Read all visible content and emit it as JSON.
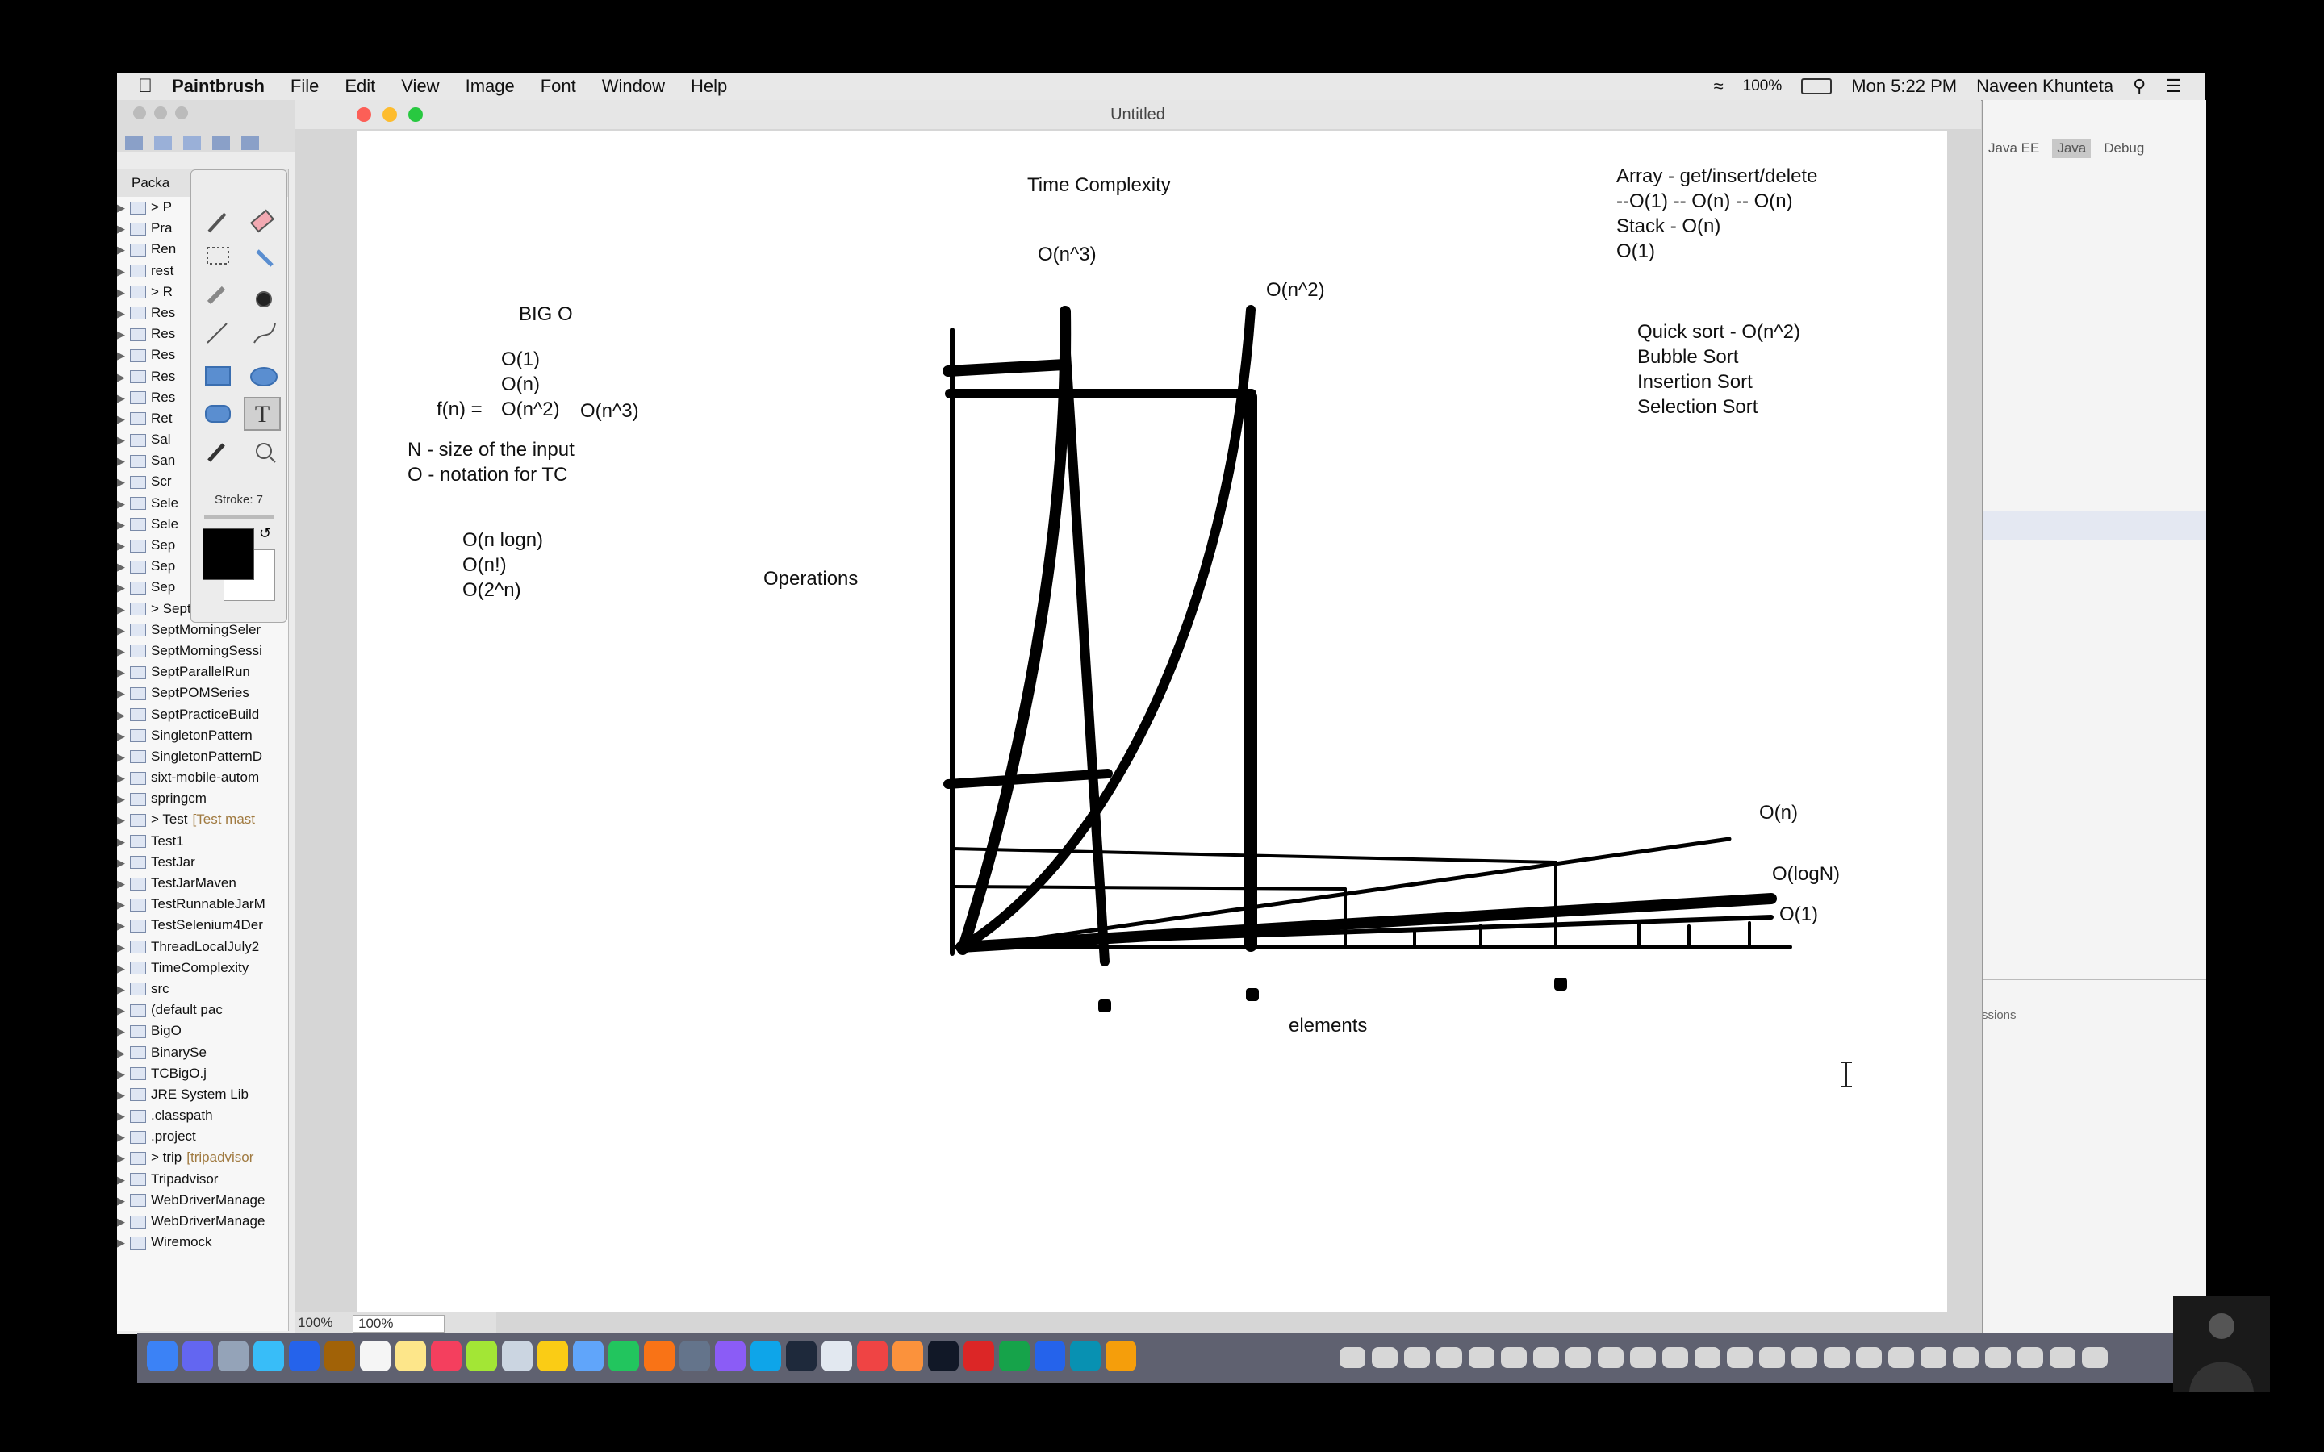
{
  "menubar": {
    "app": "Paintbrush",
    "items": [
      "File",
      "Edit",
      "View",
      "Image",
      "Font",
      "Window",
      "Help"
    ],
    "battery": "100%",
    "clock": "Mon 5:22 PM",
    "user": "Naveen Khunteta"
  },
  "window": {
    "title": "Untitled"
  },
  "eclipse": {
    "package_tab": "Packa",
    "perspectives": [
      "Java EE",
      "Java",
      "Debug"
    ],
    "sessions_label": "ssions",
    "tree": [
      {
        "label": "> P",
        "deco": ""
      },
      {
        "label": "Pra",
        "deco": ""
      },
      {
        "label": "Ren",
        "deco": ""
      },
      {
        "label": "rest",
        "deco": ""
      },
      {
        "label": "> R",
        "deco": ""
      },
      {
        "label": "Res",
        "deco": ""
      },
      {
        "label": "Res",
        "deco": ""
      },
      {
        "label": "Res",
        "deco": ""
      },
      {
        "label": "Res",
        "deco": ""
      },
      {
        "label": "Res",
        "deco": ""
      },
      {
        "label": "Ret",
        "deco": ""
      },
      {
        "label": "Sal",
        "deco": ""
      },
      {
        "label": "San",
        "deco": ""
      },
      {
        "label": "Scr",
        "deco": ""
      },
      {
        "label": "Sele",
        "deco": ""
      },
      {
        "label": "Sele",
        "deco": ""
      },
      {
        "label": "Sep",
        "deco": ""
      },
      {
        "label": "Sep",
        "deco": ""
      },
      {
        "label": "Sep",
        "deco": ""
      },
      {
        "label": "> SeptMorningSel",
        "deco": ""
      },
      {
        "label": "SeptMorningSeler",
        "deco": ""
      },
      {
        "label": "SeptMorningSessi",
        "deco": ""
      },
      {
        "label": "SeptParallelRun",
        "deco": ""
      },
      {
        "label": "SeptPOMSeries",
        "deco": ""
      },
      {
        "label": "SeptPracticeBuild",
        "deco": ""
      },
      {
        "label": "SingletonPattern",
        "deco": ""
      },
      {
        "label": "SingletonPatternD",
        "deco": ""
      },
      {
        "label": "sixt-mobile-autom",
        "deco": ""
      },
      {
        "label": "springcm",
        "deco": ""
      },
      {
        "label": "> Test",
        "deco": "[Test mast"
      },
      {
        "label": "Test1",
        "deco": ""
      },
      {
        "label": "TestJar",
        "deco": ""
      },
      {
        "label": "TestJarMaven",
        "deco": ""
      },
      {
        "label": "TestRunnableJarM",
        "deco": ""
      },
      {
        "label": "TestSelenium4Der",
        "deco": ""
      },
      {
        "label": "ThreadLocalJuly2",
        "deco": ""
      },
      {
        "label": "TimeComplexity",
        "deco": ""
      },
      {
        "label": "src",
        "deco": ""
      },
      {
        "label": "(default pac",
        "deco": ""
      },
      {
        "label": "BigO",
        "deco": ""
      },
      {
        "label": "BinarySe",
        "deco": ""
      },
      {
        "label": "TCBigO.j",
        "deco": ""
      },
      {
        "label": "JRE System Lib",
        "deco": ""
      },
      {
        "label": ".classpath",
        "deco": ""
      },
      {
        "label": ".project",
        "deco": ""
      },
      {
        "label": "> trip",
        "deco": "[tripadvisor"
      },
      {
        "label": "Tripadvisor",
        "deco": ""
      },
      {
        "label": "WebDriverManage",
        "deco": ""
      },
      {
        "label": "WebDriverManage",
        "deco": ""
      },
      {
        "label": "Wiremock",
        "deco": ""
      }
    ]
  },
  "tools": {
    "stroke_label": "Stroke: 7"
  },
  "zoom": {
    "value1": "100%",
    "value2": "100%"
  },
  "canvas": {
    "title": "Time Complexity",
    "bigo_title": "BIG O",
    "complexities_a": [
      "O(1)",
      "O(n)",
      "O(n^2)"
    ],
    "fn_label": "f(n) =",
    "cubic": "O(n^3)",
    "defs": [
      "N - size of the input",
      "O - notation for TC"
    ],
    "complexities_b": [
      "O(n logn)",
      "O(n!)",
      "O(2^n)"
    ],
    "array_notes": [
      "Array - get/insert/delete",
      "--O(1) -- O(n) -- O(n)",
      "Stack - O(n)",
      "O(1)"
    ],
    "sorts": [
      "Quick sort - O(n^2)",
      "Bubble Sort",
      "Insertion Sort",
      "Selection Sort"
    ],
    "y_label": "Operations",
    "x_label": "elements",
    "curve_labels": {
      "n3": "O(n^3)",
      "n2": "O(n^2)",
      "n": "O(n)",
      "logn": "O(logN)",
      "one": "O(1)"
    }
  }
}
